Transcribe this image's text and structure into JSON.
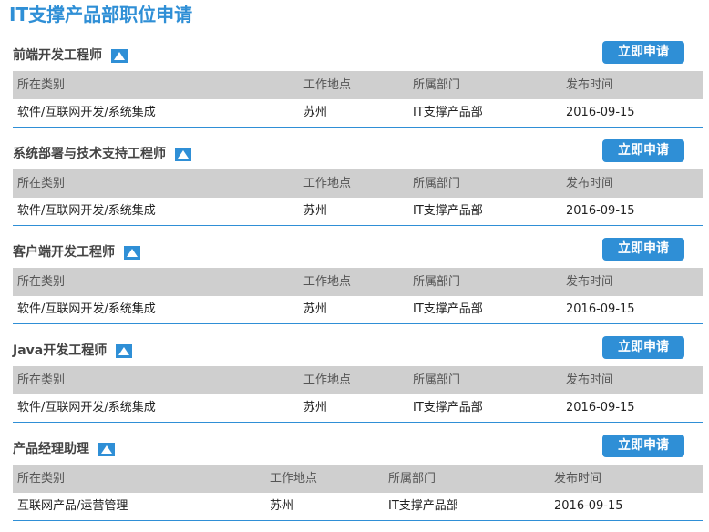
{
  "page": {
    "title": "IT支撑产品部职位申请"
  },
  "table_headers": {
    "category": "所在类别",
    "location": "工作地点",
    "department": "所属部门",
    "date": "发布时间"
  },
  "apply_label": "立即申请",
  "jobs": [
    {
      "title": "前端开发工程师",
      "category": "软件/互联网开发/系统集成",
      "location": "苏州",
      "department": "IT支撑产品部",
      "date": "2016-09-15"
    },
    {
      "title": "系统部署与技术支持工程师",
      "category": "软件/互联网开发/系统集成",
      "location": "苏州",
      "department": "IT支撑产品部",
      "date": "2016-09-15"
    },
    {
      "title": "客户端开发工程师",
      "category": "软件/互联网开发/系统集成",
      "location": "苏州",
      "department": "IT支撑产品部",
      "date": "2016-09-15"
    },
    {
      "title": "Java开发工程师",
      "category": "软件/互联网开发/系统集成",
      "location": "苏州",
      "department": "IT支撑产品部",
      "date": "2016-09-15"
    },
    {
      "title": "产品经理助理",
      "category": "互联网产品/运营管理",
      "location": "苏州",
      "department": "IT支撑产品部",
      "date": "2016-09-15"
    }
  ],
  "colors": {
    "accent": "#2f8fd6",
    "header_bg": "#cfcfcf"
  }
}
